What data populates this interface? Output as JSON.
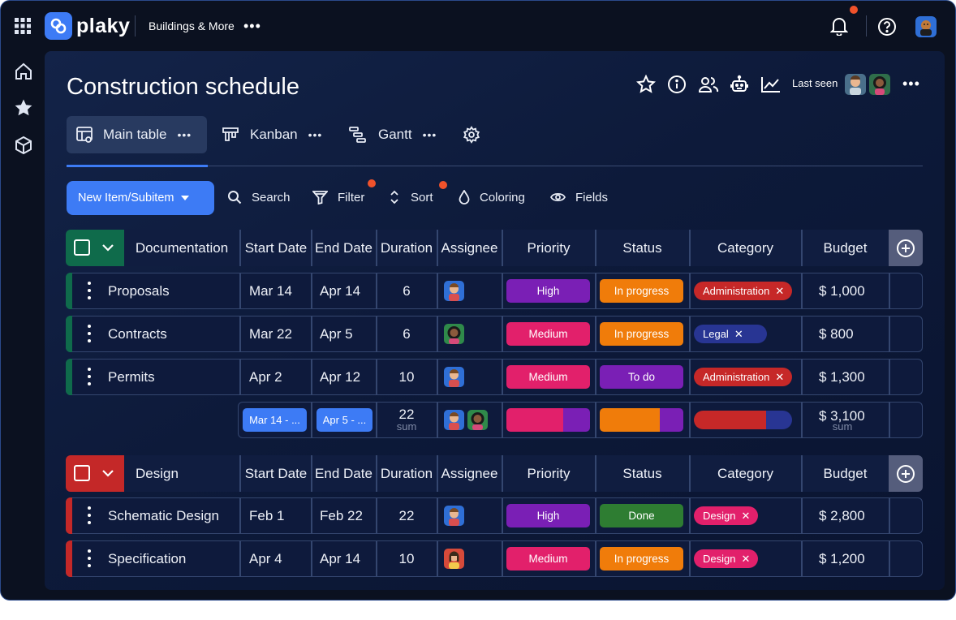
{
  "app": {
    "brand": "plaky",
    "workspace": "Buildings & More"
  },
  "board": {
    "title": "Construction schedule",
    "last_seen_label": "Last seen",
    "views": [
      {
        "label": "Main table"
      },
      {
        "label": "Kanban"
      },
      {
        "label": "Gantt"
      }
    ]
  },
  "toolbar": {
    "new_item": "New Item/Subitem",
    "search": "Search",
    "filter": "Filter",
    "sort": "Sort",
    "coloring": "Coloring",
    "fields": "Fields"
  },
  "columns": [
    "Start Date",
    "End Date",
    "Duration",
    "Assignee",
    "Priority",
    "Status",
    "Category",
    "Budget"
  ],
  "colors": {
    "high": "#7a1fb5",
    "medium": "#e2206b",
    "in_progress": "#f07c0a",
    "todo": "#7a1fb5",
    "done": "#2e7d32",
    "administration": "#c62828",
    "legal": "#283593",
    "design": "#e2206b"
  },
  "groups": [
    {
      "name": "Documentation",
      "color": "#0f6b4b",
      "items": [
        {
          "name": "Proposals",
          "start": "Mar 14",
          "end": "Apr 14",
          "duration": "6",
          "priority": "High",
          "status": "In progress",
          "category": "Administration",
          "budget": "$ 1,000"
        },
        {
          "name": "Contracts",
          "start": "Mar 22",
          "end": "Apr 5",
          "duration": "6",
          "priority": "Medium",
          "status": "In progress",
          "category": "Legal",
          "budget": "$ 800"
        },
        {
          "name": "Permits",
          "start": "Apr 2",
          "end": "Apr 12",
          "duration": "10",
          "priority": "Medium",
          "status": "To do",
          "category": "Administration",
          "budget": "$ 1,300"
        }
      ],
      "summary": {
        "start": "Mar 14 - ...",
        "end": "Apr 5 - ...",
        "duration": "22",
        "duration_sub": "sum",
        "budget": "$ 3,100",
        "budget_sub": "sum"
      }
    },
    {
      "name": "Design",
      "color": "#c42828",
      "items": [
        {
          "name": "Schematic Design",
          "start": "Feb 1",
          "end": "Feb 22",
          "duration": "22",
          "priority": "High",
          "status": "Done",
          "category": "Design",
          "budget": "$ 2,800"
        },
        {
          "name": "Specification",
          "start": "Apr 4",
          "end": "Apr 14",
          "duration": "10",
          "priority": "Medium",
          "status": "In progress",
          "category": "Design",
          "budget": "$ 1,200"
        }
      ]
    }
  ]
}
